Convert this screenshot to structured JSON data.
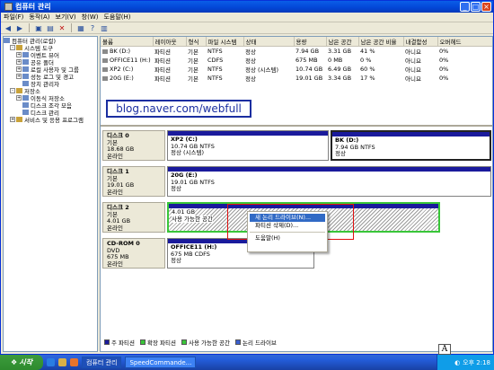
{
  "window": {
    "title": "컴퓨터 관리"
  },
  "menu": [
    "파일(F)",
    "동작(A)",
    "보기(V)",
    "창(W)",
    "도움말(H)"
  ],
  "tree": {
    "root": "컴퓨터 관리(로컬)",
    "items": [
      {
        "label": "시스템 도구",
        "level": 1,
        "expander": "-"
      },
      {
        "label": "이벤트 뷰어",
        "level": 2,
        "expander": "+"
      },
      {
        "label": "공유 폴더",
        "level": 2,
        "expander": "+"
      },
      {
        "label": "로컬 사용자 및 그룹",
        "level": 2,
        "expander": "+"
      },
      {
        "label": "성능 로그 및 경고",
        "level": 2,
        "expander": "+"
      },
      {
        "label": "장치 관리자",
        "level": 2,
        "expander": ""
      },
      {
        "label": "저장소",
        "level": 1,
        "expander": "-"
      },
      {
        "label": "이동식 저장소",
        "level": 2,
        "expander": "+"
      },
      {
        "label": "디스크 조각 모음",
        "level": 2,
        "expander": ""
      },
      {
        "label": "디스크 관리",
        "level": 2,
        "expander": ""
      },
      {
        "label": "서비스 및 응용 프로그램",
        "level": 1,
        "expander": "+"
      }
    ]
  },
  "volume_table": {
    "headers": [
      "볼륨",
      "레이아웃",
      "형식",
      "파일 시스템",
      "상태",
      "용량",
      "남은 공간",
      "남은 공간 비율",
      "내결함성",
      "오버헤드"
    ],
    "rows": [
      [
        "BK (D:)",
        "파티션",
        "기본",
        "NTFS",
        "정상",
        "7.94 GB",
        "3.31 GB",
        "41 %",
        "아니요",
        "0%"
      ],
      [
        "OFFICE11 (H:)",
        "파티션",
        "기본",
        "CDFS",
        "정상",
        "675 MB",
        "0 MB",
        "0 %",
        "아니요",
        "0%"
      ],
      [
        "XP2 (C:)",
        "파티션",
        "기본",
        "NTFS",
        "정상 (시스템)",
        "10.74 GB",
        "6.49 GB",
        "60 %",
        "아니요",
        "0%"
      ],
      [
        "20G (E:)",
        "파티션",
        "기본",
        "NTFS",
        "정상",
        "19.01 GB",
        "3.34 GB",
        "17 %",
        "아니요",
        "0%"
      ]
    ]
  },
  "watermark": "blog.naver.com/webfull",
  "disks": [
    {
      "name": "디스크 0",
      "type": "기본",
      "size": "18.68 GB",
      "status": "온라인",
      "partitions": [
        {
          "name": "XP2  (C:)",
          "size": "10.74 GB NTFS",
          "status": "정상 (시스템)"
        },
        {
          "name": "BK  (D:)",
          "size": "7.94 GB NTFS",
          "status": "정상"
        }
      ]
    },
    {
      "name": "디스크 1",
      "type": "기본",
      "size": "19.01 GB",
      "status": "온라인",
      "partitions": [
        {
          "name": "20G  (E:)",
          "size": "19.01 GB NTFS",
          "status": "정상"
        }
      ]
    },
    {
      "name": "디스크 2",
      "type": "기본",
      "size": "4.01 GB",
      "status": "온라인",
      "partitions": [
        {
          "name": "",
          "size": "4.01 GB",
          "status": "사용 가능한 공간"
        }
      ]
    },
    {
      "name": "CD-ROM 0",
      "type": "DVD",
      "size": "675 MB",
      "status": "온라인",
      "partitions": [
        {
          "name": "OFFICE11  (H:)",
          "size": "675 MB CDFS",
          "status": "정상"
        }
      ]
    }
  ],
  "context_menu": {
    "items": [
      "새 논리 드라이브(N)...",
      "파티션 삭제(D)...",
      "도움말(H)"
    ],
    "highlighted": 0
  },
  "legend": [
    {
      "label": "주 파티션",
      "color": "#1a1a9c"
    },
    {
      "label": "확장 파티션",
      "color": "#39c639"
    },
    {
      "label": "사용 가능한 공간",
      "color": "#39c639"
    },
    {
      "label": "논리 드라이브",
      "color": "#3a5fd0"
    }
  ],
  "taskbar": {
    "start": "시작",
    "items": [
      "컴퓨터 관리",
      "SpeedCommande..."
    ],
    "clock": "오후 2:18"
  },
  "ime": "A"
}
